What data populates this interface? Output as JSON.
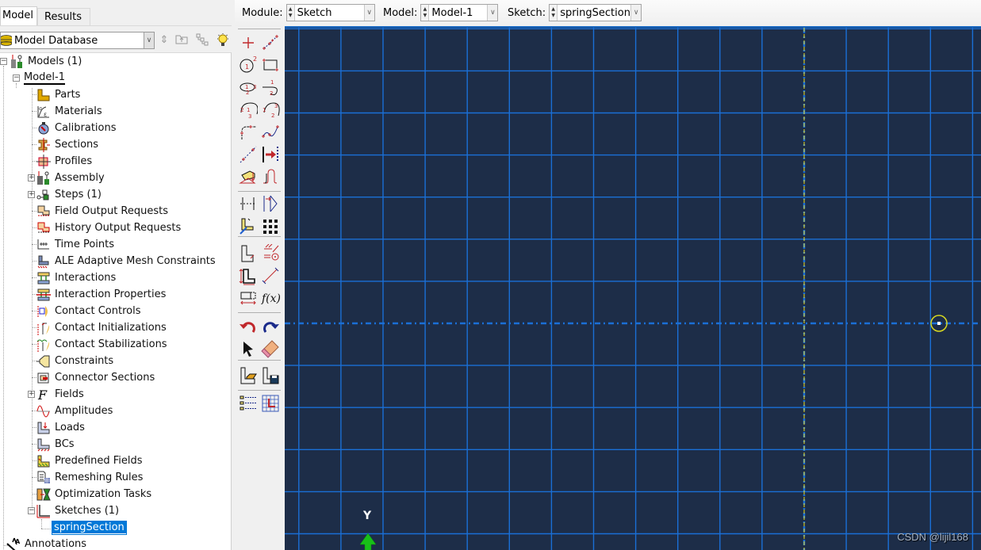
{
  "left_panel": {
    "tabs": [
      {
        "label": "Model",
        "active": true
      },
      {
        "label": "Results",
        "active": false
      }
    ],
    "database_select": {
      "value": "Model Database"
    },
    "toolbar_buttons": [
      "expand-collapse-icon",
      "go-up-icon",
      "tree-filter-icon",
      "hint-lightbulb-icon"
    ],
    "tree": {
      "root": {
        "label": "Models (1)",
        "icon": "models-icon"
      },
      "model": {
        "label": "Model-1"
      },
      "items": [
        {
          "label": "Parts",
          "icon": "parts-icon",
          "expandable": false
        },
        {
          "label": "Materials",
          "icon": "materials-icon",
          "expandable": false
        },
        {
          "label": "Calibrations",
          "icon": "calibrations-icon",
          "expandable": false
        },
        {
          "label": "Sections",
          "icon": "sections-icon",
          "expandable": false
        },
        {
          "label": "Profiles",
          "icon": "profiles-icon",
          "expandable": false
        },
        {
          "label": "Assembly",
          "icon": "assembly-icon",
          "expandable": true
        },
        {
          "label": "Steps (1)",
          "icon": "steps-icon",
          "expandable": true
        },
        {
          "label": "Field Output Requests",
          "icon": "field-output-icon",
          "expandable": false
        },
        {
          "label": "History Output Requests",
          "icon": "history-output-icon",
          "expandable": false
        },
        {
          "label": "Time Points",
          "icon": "time-points-icon",
          "expandable": false
        },
        {
          "label": "ALE Adaptive Mesh Constraints",
          "icon": "ale-mesh-icon",
          "expandable": false
        },
        {
          "label": "Interactions",
          "icon": "interactions-icon",
          "expandable": false
        },
        {
          "label": "Interaction Properties",
          "icon": "interaction-properties-icon",
          "expandable": false
        },
        {
          "label": "Contact Controls",
          "icon": "contact-controls-icon",
          "expandable": false
        },
        {
          "label": "Contact Initializations",
          "icon": "contact-initializations-icon",
          "expandable": false
        },
        {
          "label": "Contact Stabilizations",
          "icon": "contact-stabilizations-icon",
          "expandable": false
        },
        {
          "label": "Constraints",
          "icon": "constraints-icon",
          "expandable": false
        },
        {
          "label": "Connector Sections",
          "icon": "connector-sections-icon",
          "expandable": false
        },
        {
          "label": "Fields",
          "icon": "fields-icon",
          "expandable": true
        },
        {
          "label": "Amplitudes",
          "icon": "amplitudes-icon",
          "expandable": false
        },
        {
          "label": "Loads",
          "icon": "loads-icon",
          "expandable": false
        },
        {
          "label": "BCs",
          "icon": "bcs-icon",
          "expandable": false
        },
        {
          "label": "Predefined Fields",
          "icon": "predefined-fields-icon",
          "expandable": false
        },
        {
          "label": "Remeshing Rules",
          "icon": "remeshing-rules-icon",
          "expandable": false
        },
        {
          "label": "Optimization Tasks",
          "icon": "optimization-tasks-icon",
          "expandable": false
        },
        {
          "label": "Sketches (1)",
          "icon": "sketches-icon",
          "expandable": true,
          "expanded": true
        }
      ],
      "sketch_child": {
        "label": "springSection",
        "selected": true
      },
      "annotations": {
        "label": "Annotations",
        "icon": "annotations-icon"
      }
    }
  },
  "context_bar": {
    "module": {
      "label": "Module:",
      "value": "Sketch"
    },
    "model": {
      "label": "Model:",
      "value": "Model-1"
    },
    "sketch": {
      "label": "Sketch:",
      "value": "springSection"
    }
  },
  "toolbox": {
    "tools": [
      "create-isolated-point",
      "create-lines-connected",
      "create-circle-center-perimeter",
      "create-rectangle",
      "create-ellipse",
      "create-arc-tangent",
      "create-arc-center-endpoints",
      "create-arc-three-points",
      "create-fillet",
      "create-spline",
      "create-construction-line",
      "offset-curves",
      "project-edges",
      "create-wire",
      "add-constraint",
      "mirror",
      "sketch-options-corner",
      "pattern-linear",
      "add-dimension",
      "auto-constrain",
      "edit-dimension",
      "radial-dimension",
      "parameter-manager",
      "fx-parameters",
      "undo",
      "redo",
      "select-pointer",
      "delete-eraser",
      "open-sketch",
      "save-sketch",
      "sketch-list",
      "sketch-grid-options"
    ]
  },
  "canvas": {
    "background_color": "#1d2d48",
    "grid_color": "#1a6fd6",
    "y_axis_label": "Y",
    "watermark": "CSDN @lijil168"
  }
}
